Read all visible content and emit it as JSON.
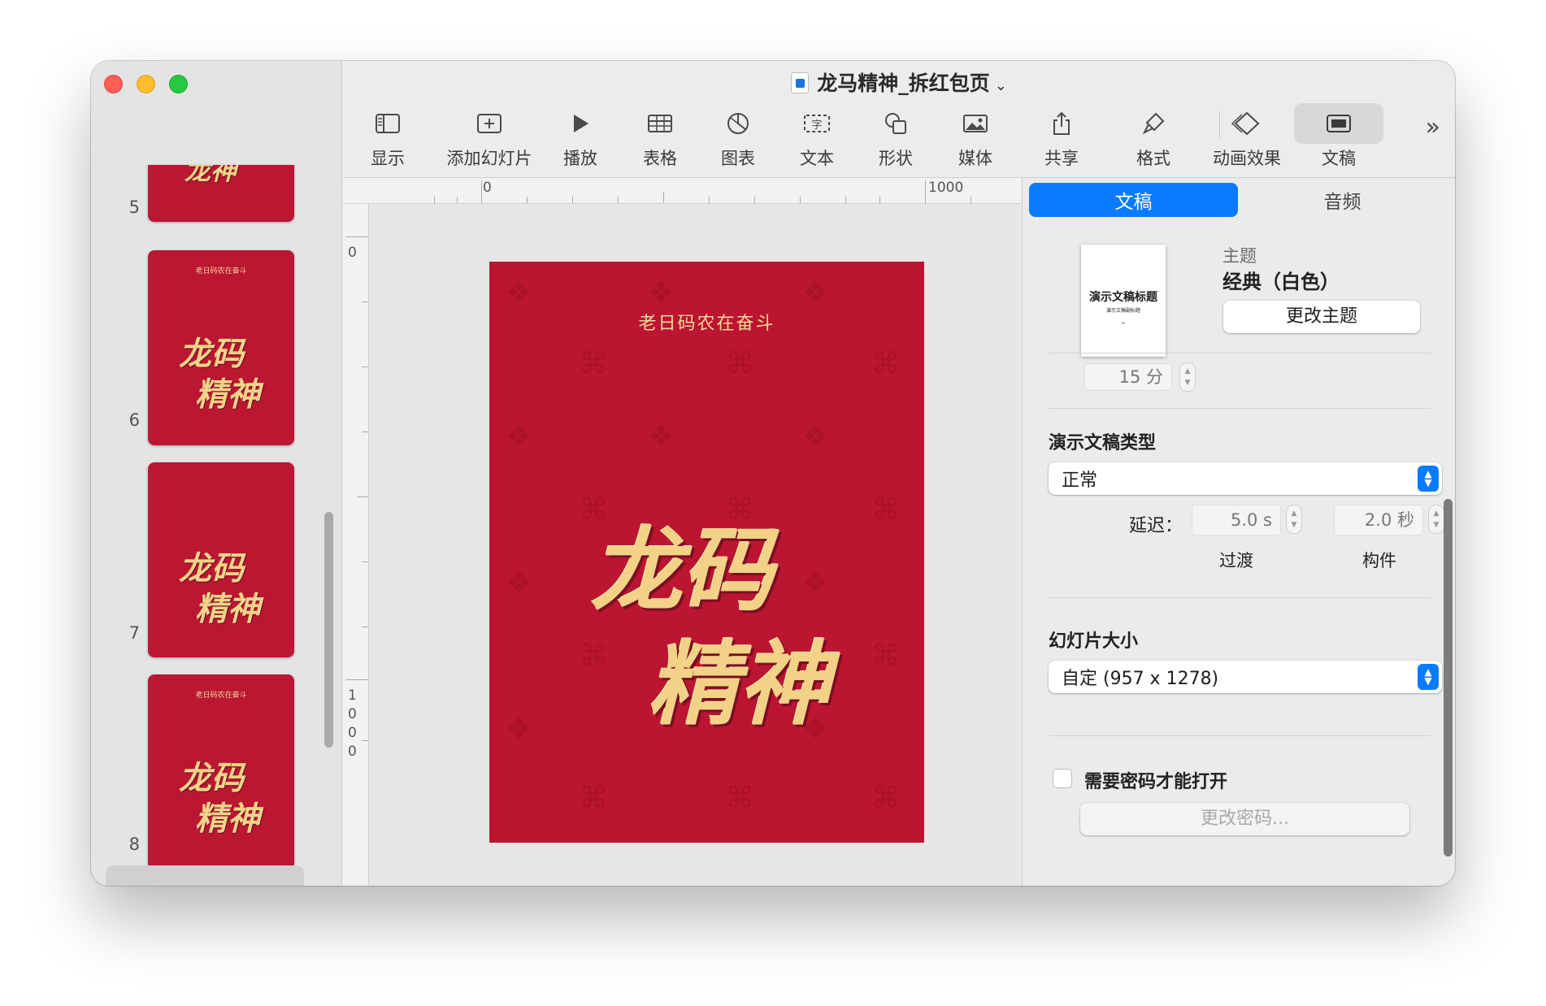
{
  "window": {
    "title": "龙马精神_拆红包页"
  },
  "sidebar": {
    "slides": [
      {
        "number": "5"
      },
      {
        "number": "6",
        "subtitle": "老日码农在奋斗",
        "title_line1": "龙码",
        "title_line2": "精神"
      },
      {
        "number": "7",
        "title_line1": "龙码",
        "title_line2": "精神"
      },
      {
        "number": "8",
        "subtitle": "老日码农在奋斗",
        "title_line1": "龙码",
        "title_line2": "精神"
      }
    ]
  },
  "toolbar": {
    "items": [
      {
        "label": "显示",
        "icon": "sidebar-icon"
      },
      {
        "label": "添加幻灯片",
        "icon": "add-slide-icon"
      },
      {
        "label": "播放",
        "icon": "play-icon"
      },
      {
        "label": "表格",
        "icon": "table-icon"
      },
      {
        "label": "图表",
        "icon": "chart-icon"
      },
      {
        "label": "文本",
        "icon": "text-icon"
      },
      {
        "label": "形状",
        "icon": "shape-icon"
      },
      {
        "label": "媒体",
        "icon": "media-icon"
      },
      {
        "label": "共享",
        "icon": "share-icon"
      },
      {
        "label": "格式",
        "icon": "format-brush-icon"
      },
      {
        "label": "动画效果",
        "icon": "animate-icon"
      },
      {
        "label": "文稿",
        "icon": "document-icon"
      }
    ]
  },
  "ruler": {
    "h_labels": [
      "0",
      "1000"
    ],
    "v_label_zero": "0",
    "v_label_1000": [
      "1",
      "0",
      "0",
      "0"
    ]
  },
  "slide": {
    "subtitle": "老日码农在奋斗",
    "title_line1": "龙码",
    "title_line2": "精神",
    "background_color": "#bc1531",
    "text_color": "#f1d287"
  },
  "inspector": {
    "tabs": [
      "文稿",
      "音频"
    ],
    "theme_thumb": {
      "title": "演示文稿标题",
      "subtitle": "演示文稿副标题",
      "dash": "–"
    },
    "theme_label": "主题",
    "theme_name": "经典（白色）",
    "change_theme": "更改主题",
    "duration_value": "15 分",
    "presentation_type_label": "演示文稿类型",
    "presentation_type_value": "正常",
    "delay_label": "延迟：",
    "transition_value": "5.0 s",
    "transition_label": "过渡",
    "build_value": "2.0 秒",
    "build_label": "构件",
    "slide_size_label": "幻灯片大小",
    "slide_size_value": "自定 (957 x 1278)",
    "password_label": "需要密码才能打开",
    "change_password": "更改密码..."
  }
}
